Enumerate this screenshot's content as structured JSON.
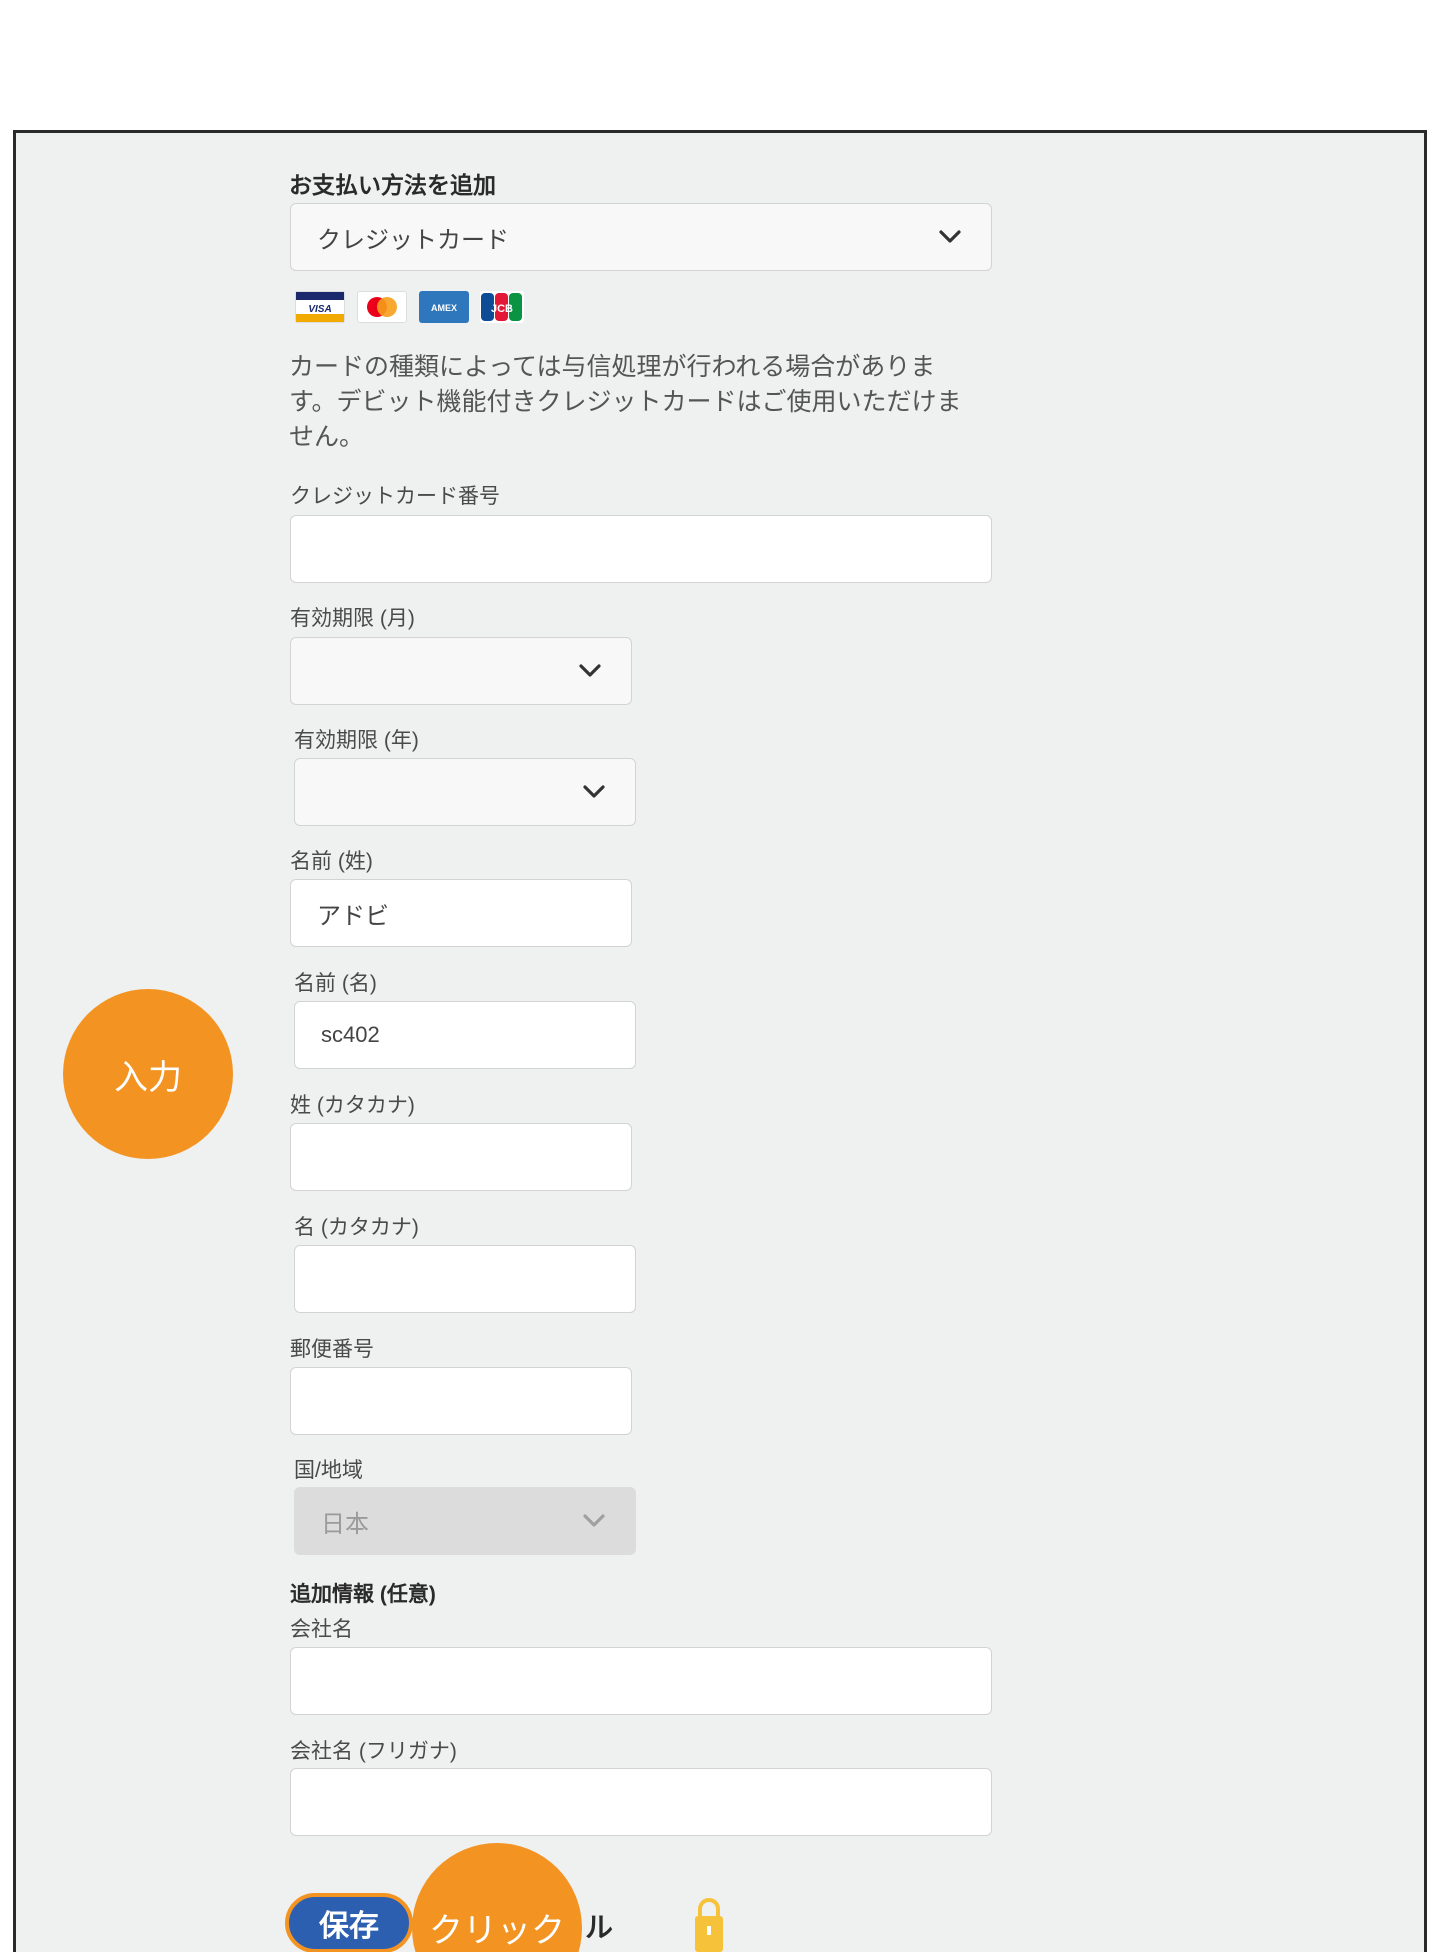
{
  "form": {
    "section_title": "お支払い方法を追加",
    "payment_method": {
      "value": "クレジットカード"
    },
    "card_brands": [
      "VISA",
      "Mastercard",
      "AMEX",
      "JCB"
    ],
    "description": "カードの種類によっては与信処理が行われる場合がありま す。デビット機能付きクレジットカードはご使用いただけま せん。",
    "description_lines": [
      "カードの種類によっては与信処理が行われる場合がありま",
      "す。デビット機能付きクレジットカードはご使用いただけま",
      "せん。"
    ],
    "card_number": {
      "label": "クレジットカード番号",
      "value": ""
    },
    "expiry_month": {
      "label": "有効期限 (月)",
      "value": ""
    },
    "expiry_year": {
      "label": "有効期限 (年)",
      "value": ""
    },
    "last_name": {
      "label": "名前 (姓)",
      "value": "アドビ"
    },
    "first_name": {
      "label": "名前 (名)",
      "value": "sc402"
    },
    "last_name_kana": {
      "label": "姓 (カタカナ)",
      "value": ""
    },
    "first_name_kana": {
      "label": "名 (カタカナ)",
      "value": ""
    },
    "postal_code": {
      "label": "郵便番号",
      "value": ""
    },
    "country": {
      "label": "国/地域",
      "value": "日本"
    },
    "additional_info_title": "追加情報 (任意)",
    "company": {
      "label": "会社名",
      "value": ""
    },
    "company_kana": {
      "label": "会社名 (フリガナ)",
      "value": ""
    },
    "save_label": "保存",
    "cancel_label_partial": "ル"
  },
  "annotations": {
    "input_bubble": "入力",
    "click_bubble": "クリック"
  },
  "colors": {
    "accent_orange": "#f39422",
    "save_blue": "#2d5fb0",
    "panel_bg": "#eff0f0",
    "lock_yellow": "#f6c23a"
  },
  "icons": [
    "chevron-down-icon",
    "lock-icon",
    "visa-logo",
    "mastercard-logo",
    "amex-logo",
    "jcb-logo"
  ]
}
